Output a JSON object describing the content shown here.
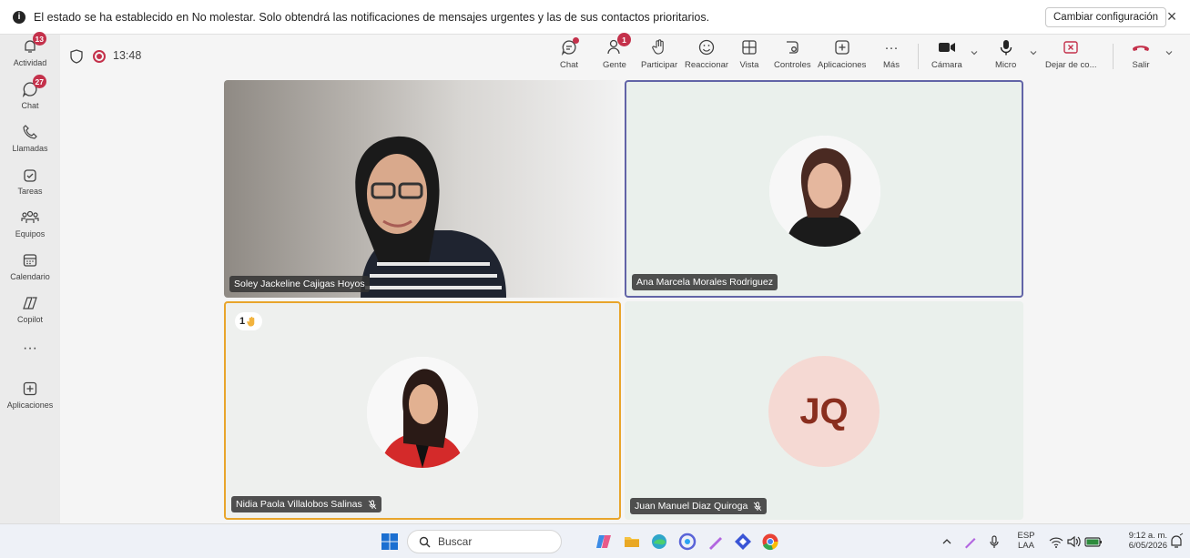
{
  "notification": {
    "message": "El estado se ha establecido en No molestar. Solo obtendrá las notificaciones de mensajes urgentes y las de sus contactos prioritarios.",
    "config_label": "Cambiar configuración"
  },
  "rail": {
    "items": [
      {
        "label": "Actividad",
        "badge": "13"
      },
      {
        "label": "Chat",
        "badge": "27"
      },
      {
        "label": "Llamadas"
      },
      {
        "label": "Tareas"
      },
      {
        "label": "Equipos"
      },
      {
        "label": "Calendario"
      },
      {
        "label": "Copilot"
      },
      {
        "label": "Aplicaciones"
      }
    ]
  },
  "meeting": {
    "timer": "13:48",
    "toolbar": {
      "chat": "Chat",
      "gente": "Gente",
      "gente_badge": "1",
      "participar": "Participar",
      "reaccionar": "Reaccionar",
      "vista": "Vista",
      "controles": "Controles",
      "aplicaciones": "Aplicaciones",
      "mas": "Más",
      "camara": "Cámara",
      "micro": "Micro",
      "dejar": "Dejar de co...",
      "salir": "Salir"
    }
  },
  "participants": [
    {
      "name": "Soley Jackeline Cajigas Hoyos"
    },
    {
      "name": "Ana Marcela Morales Rodriguez"
    },
    {
      "name": "Nidia Paola Villalobos Salinas",
      "hand_raised_order": "1"
    },
    {
      "name": "Juan Manuel Diaz Quiroga",
      "initials": "JQ"
    }
  ],
  "taskbar": {
    "search_placeholder": "Buscar",
    "lang_top": "ESP",
    "lang_bottom": "LAA",
    "time": "9:12 a. m.",
    "date": "6/05/2026"
  },
  "colors": {
    "active_speaker_border": "#6264a7",
    "hand_raised_border": "#e8a52b",
    "badge": "#c4314b"
  }
}
